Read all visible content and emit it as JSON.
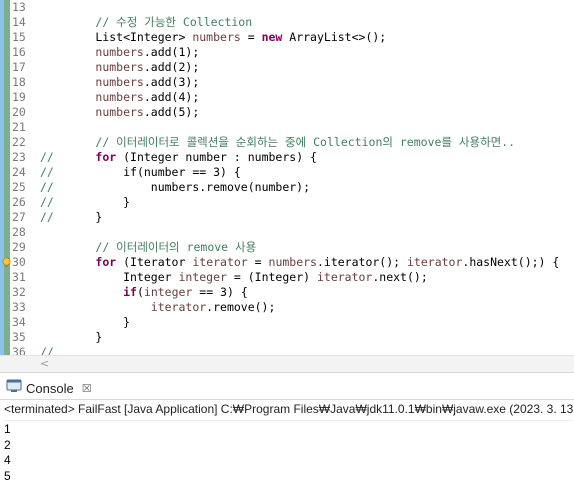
{
  "editor": {
    "lines": [
      {
        "num": "13",
        "parts": []
      },
      {
        "num": "14",
        "parts": [
          {
            "t": "        "
          },
          {
            "t": "// 수정 가능한 Collection",
            "c": "cm"
          }
        ]
      },
      {
        "num": "15",
        "parts": [
          {
            "t": "        List<Integer> "
          },
          {
            "t": "numbers",
            "c": "var"
          },
          {
            "t": " = "
          },
          {
            "t": "new",
            "c": "kw"
          },
          {
            "t": " ArrayList<>();"
          }
        ]
      },
      {
        "num": "16",
        "parts": [
          {
            "t": "        "
          },
          {
            "t": "numbers",
            "c": "var"
          },
          {
            "t": ".add(1);"
          }
        ]
      },
      {
        "num": "17",
        "parts": [
          {
            "t": "        "
          },
          {
            "t": "numbers",
            "c": "var"
          },
          {
            "t": ".add(2);"
          }
        ]
      },
      {
        "num": "18",
        "parts": [
          {
            "t": "        "
          },
          {
            "t": "numbers",
            "c": "var"
          },
          {
            "t": ".add(3);"
          }
        ]
      },
      {
        "num": "19",
        "parts": [
          {
            "t": "        "
          },
          {
            "t": "numbers",
            "c": "var"
          },
          {
            "t": ".add(4);"
          }
        ]
      },
      {
        "num": "20",
        "parts": [
          {
            "t": "        "
          },
          {
            "t": "numbers",
            "c": "var"
          },
          {
            "t": ".add(5);"
          }
        ]
      },
      {
        "num": "21",
        "parts": []
      },
      {
        "num": "22",
        "parts": [
          {
            "t": "        "
          },
          {
            "t": "// 이터레이터로 콜렉션을 순회하는 중에 Collection의 remove를 사용하면..",
            "c": "cm"
          }
        ]
      },
      {
        "num": "23",
        "parts": [
          {
            "t": "//",
            "c": "cm"
          },
          {
            "t": "      "
          },
          {
            "t": "for",
            "c": "kw"
          },
          {
            "t": " (Integer number : numbers) {"
          }
        ]
      },
      {
        "num": "24",
        "parts": [
          {
            "t": "//",
            "c": "cm"
          },
          {
            "t": "          if(number == 3) {"
          }
        ]
      },
      {
        "num": "25",
        "parts": [
          {
            "t": "//",
            "c": "cm"
          },
          {
            "t": "              numbers.remove(number);"
          }
        ]
      },
      {
        "num": "26",
        "parts": [
          {
            "t": "//",
            "c": "cm"
          },
          {
            "t": "          }"
          }
        ]
      },
      {
        "num": "27",
        "parts": [
          {
            "t": "//",
            "c": "cm"
          },
          {
            "t": "      }"
          }
        ]
      },
      {
        "num": "28",
        "parts": []
      },
      {
        "num": "29",
        "parts": [
          {
            "t": "        "
          },
          {
            "t": "// 이터레이터의 remove 사용",
            "c": "cm"
          }
        ]
      },
      {
        "num": "30",
        "warn": true,
        "parts": [
          {
            "t": "        "
          },
          {
            "t": "for",
            "c": "kw"
          },
          {
            "t": " (Iterator "
          },
          {
            "t": "iterator",
            "c": "var"
          },
          {
            "t": " = "
          },
          {
            "t": "numbers",
            "c": "var"
          },
          {
            "t": ".iterator(); "
          },
          {
            "t": "iterator",
            "c": "var"
          },
          {
            "t": ".hasNext();) {"
          }
        ]
      },
      {
        "num": "31",
        "parts": [
          {
            "t": "            Integer "
          },
          {
            "t": "integer",
            "c": "var"
          },
          {
            "t": " = (Integer) "
          },
          {
            "t": "iterator",
            "c": "var"
          },
          {
            "t": ".next();"
          }
        ]
      },
      {
        "num": "32",
        "parts": [
          {
            "t": "            "
          },
          {
            "t": "if",
            "c": "kw"
          },
          {
            "t": "("
          },
          {
            "t": "integer",
            "c": "var"
          },
          {
            "t": " == 3) {"
          }
        ]
      },
      {
        "num": "33",
        "parts": [
          {
            "t": "                "
          },
          {
            "t": "iterator",
            "c": "var"
          },
          {
            "t": ".remove();"
          }
        ]
      },
      {
        "num": "34",
        "parts": [
          {
            "t": "            }"
          }
        ]
      },
      {
        "num": "35",
        "parts": [
          {
            "t": "        }"
          }
        ]
      },
      {
        "num": "36",
        "parts": [
          {
            "t": "//",
            "c": "cm"
          }
        ]
      }
    ]
  },
  "console": {
    "tab_label": "Console",
    "close_glyph": "☒",
    "status": "<terminated> FailFast [Java Application] C:₩Program Files₩Java₩jdk11.0.1₩bin₩javaw.exe  (2023. 3. 13.",
    "output": [
      "1",
      "2",
      "4",
      "5"
    ]
  },
  "scrollbar": {
    "left_arrow": "<"
  },
  "colors": {
    "keyword": "#7f0055",
    "comment": "#3f7f5f",
    "variable": "#6a3e3e",
    "line_number": "#7a7a7a",
    "gutter_stripe": "#7fae8a"
  },
  "icons": {
    "console": "console-icon",
    "warning": "warning-lightbulb-icon",
    "close": "close-icon"
  }
}
